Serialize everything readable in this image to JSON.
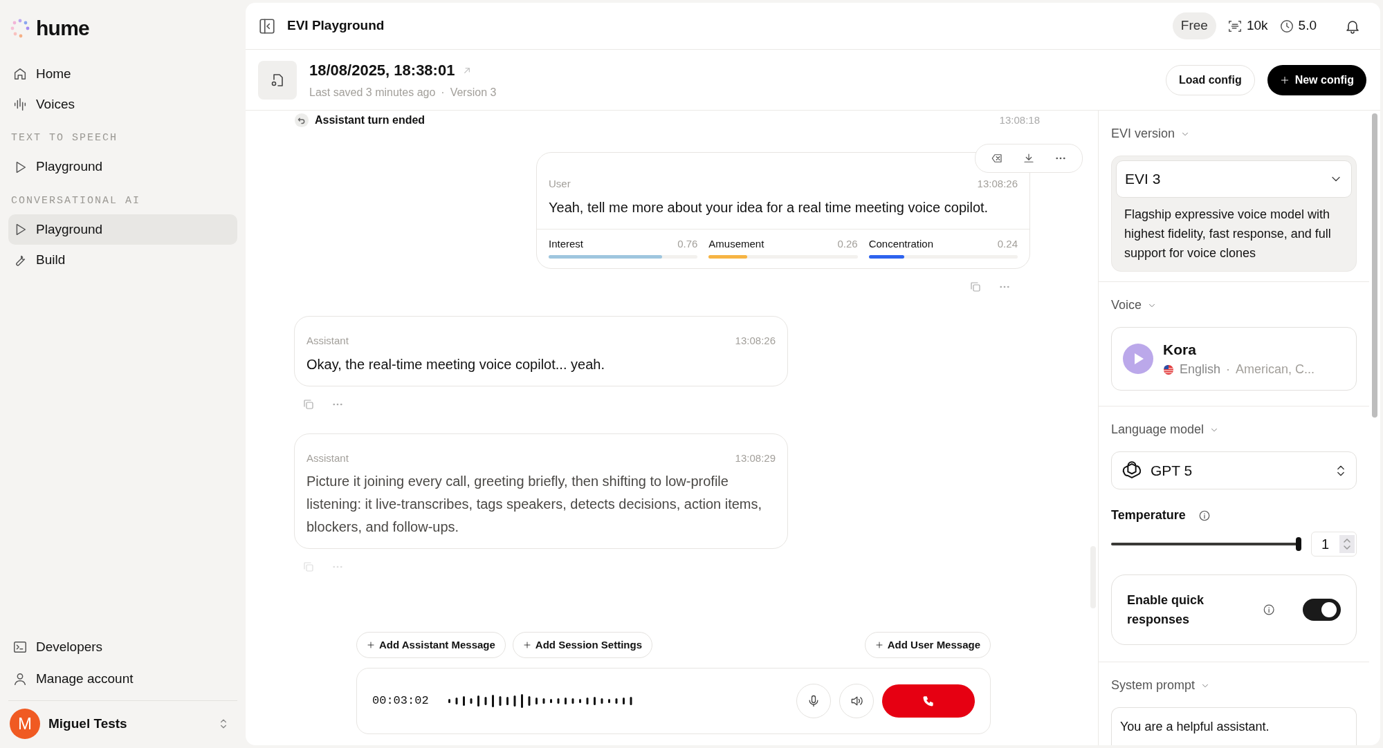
{
  "sidebar": {
    "logo": "hume",
    "nav": [
      {
        "kind": "item",
        "label": "Home",
        "selected": false
      },
      {
        "kind": "item",
        "label": "Voices",
        "selected": false
      },
      {
        "kind": "heading",
        "label": "TEXT TO SPEECH"
      },
      {
        "kind": "item",
        "label": "Playground",
        "selected": false
      },
      {
        "kind": "heading",
        "label": "CONVERSATIONAL AI"
      },
      {
        "kind": "item",
        "label": "Playground",
        "selected": true
      },
      {
        "kind": "item",
        "label": "Build",
        "selected": false
      }
    ],
    "footer": [
      "Developers",
      "Manage account"
    ],
    "user": {
      "initial": "M",
      "name": "Miguel Tests"
    }
  },
  "topbar": {
    "title": "EVI Playground",
    "plan": "Free",
    "credits": "10k",
    "minutes": "5.0"
  },
  "config": {
    "title": "18/08/2025, 18:38:01",
    "saved": "Last saved 3 minutes ago",
    "separator": "·",
    "version": "Version 3",
    "buttons": [
      "Load config",
      "New config"
    ]
  },
  "chat": {
    "event": {
      "label": "Assistant turn ended",
      "time": "13:08:18"
    },
    "messages": [
      {
        "role": "User",
        "time": "13:08:26",
        "text": "Yeah, tell me more about your idea for a real time meeting voice copilot.",
        "emotions": [
          {
            "name": "Interest",
            "score": "0.76",
            "level": 0.76,
            "color": "#9fc6df"
          },
          {
            "name": "Amusement",
            "score": "0.26",
            "level": 0.26,
            "color": "#f6b443"
          },
          {
            "name": "Concentration",
            "score": "0.24",
            "level": 0.24,
            "color": "#2d63ee"
          }
        ]
      },
      {
        "role": "Assistant",
        "time": "13:08:26",
        "text": "Okay, the real-time meeting voice copilot... yeah."
      },
      {
        "role": "Assistant",
        "time": "13:08:29",
        "text": "Picture it joining every call, greeting briefly, then shifting to low-profile listening: it live-transcribes, tags speakers, detects decisions, action items, blockers, and follow-ups."
      }
    ],
    "actions": [
      "Add Assistant Message",
      "Add Session Settings",
      "Add User Message"
    ],
    "timer": "00:03:02"
  },
  "settings": {
    "evi_version": {
      "heading": "EVI version",
      "value": "EVI 3",
      "description": "Flagship expressive voice model with highest fidelity, fast response, and full support for voice clones"
    },
    "voice": {
      "heading": "Voice",
      "name": "Kora",
      "language": "English",
      "separator": "·",
      "accent": "American, C..."
    },
    "language_model": {
      "heading": "Language model",
      "value": "GPT 5"
    },
    "temperature": {
      "label": "Temperature",
      "level": 1,
      "value": "1"
    },
    "quick_responses": {
      "label": "Enable quick responses",
      "on": true
    },
    "system_prompt": {
      "heading": "System prompt",
      "value": "You are a helpful assistant."
    }
  }
}
